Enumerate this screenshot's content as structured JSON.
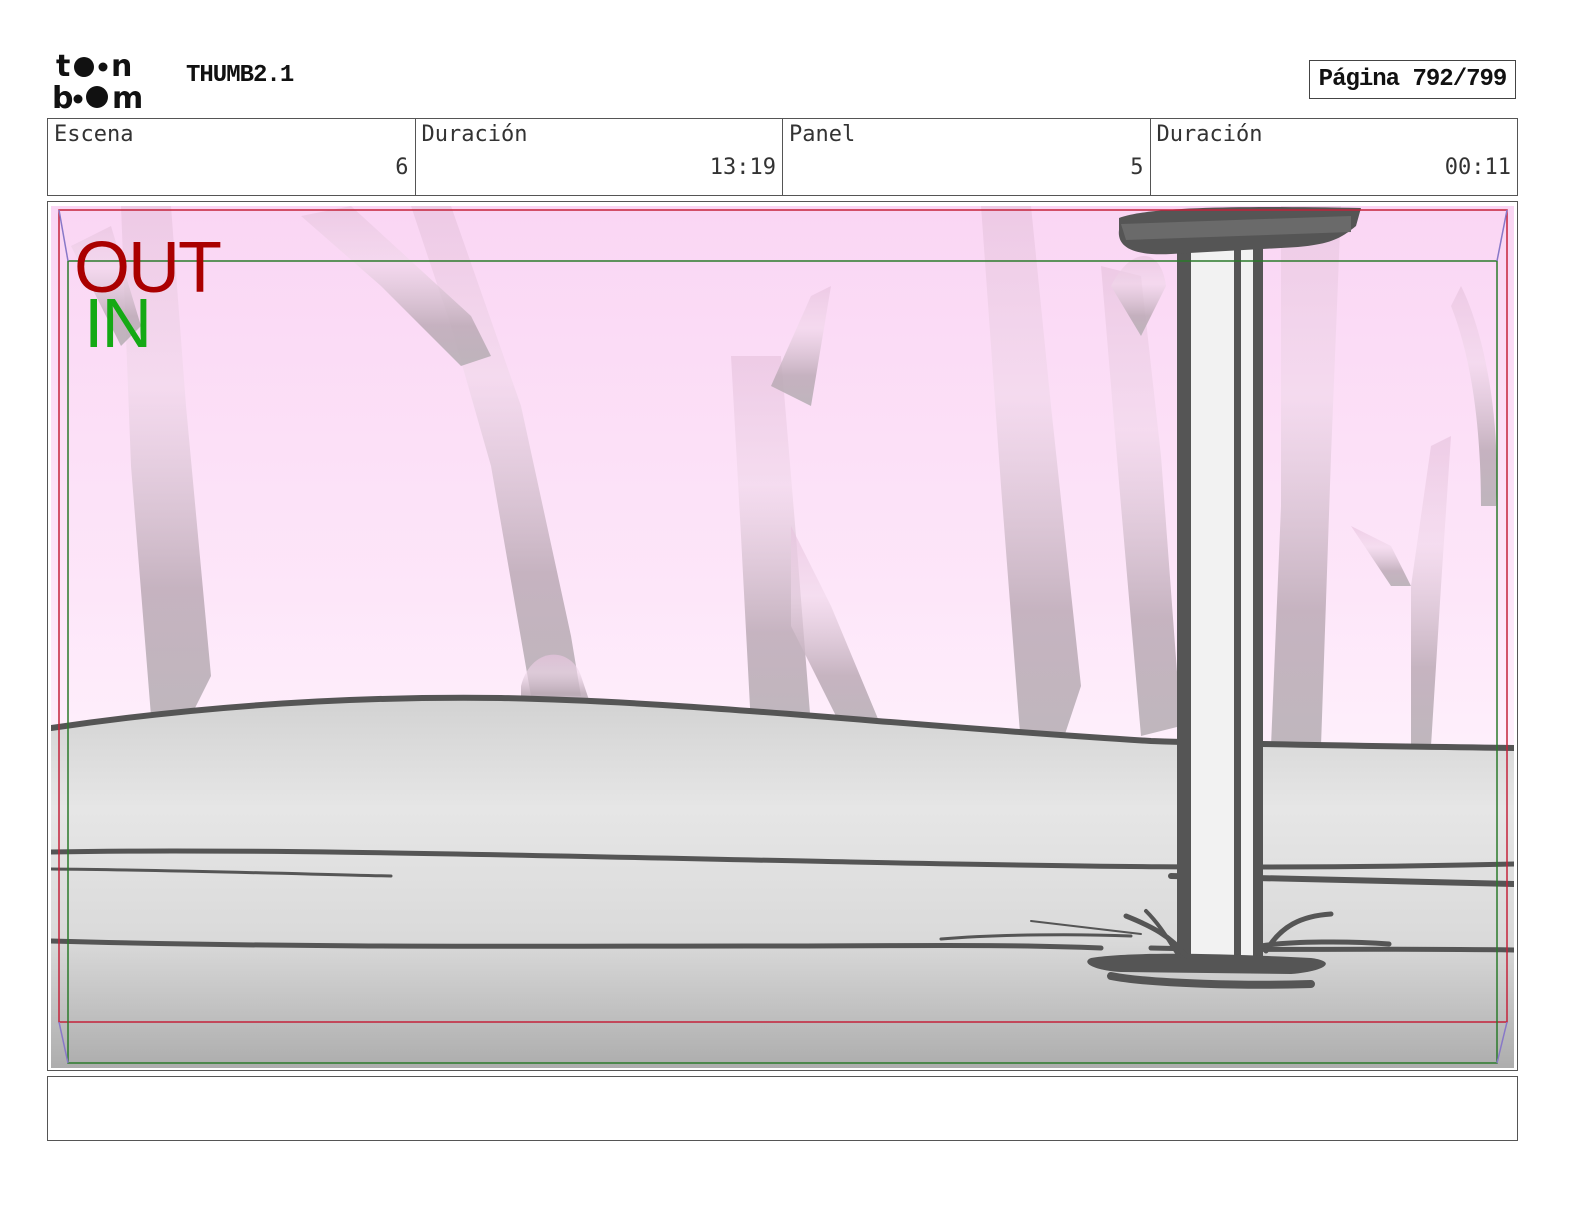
{
  "header": {
    "logo_icon": "toonboom-logo-icon",
    "logo_text": "toon boom",
    "project_title": "THUMB2.1",
    "page_indicator": "Página 792/799"
  },
  "info": {
    "scene_label": "Escena",
    "scene_value": "6",
    "scene_duration_label": "Duración",
    "scene_duration_value": "13:19",
    "panel_label": "Panel",
    "panel_value": "5",
    "panel_duration_label": "Duración",
    "panel_duration_value": "00:11"
  },
  "panel": {
    "out_label": "OUT",
    "in_label": "IN",
    "out_color": "#aa0000",
    "in_color": "#15a915",
    "sky_color": "#fcdcf6",
    "ground_color": "#dcdcdc",
    "stroke_color": "#555555"
  },
  "notes": {
    "text": ""
  }
}
